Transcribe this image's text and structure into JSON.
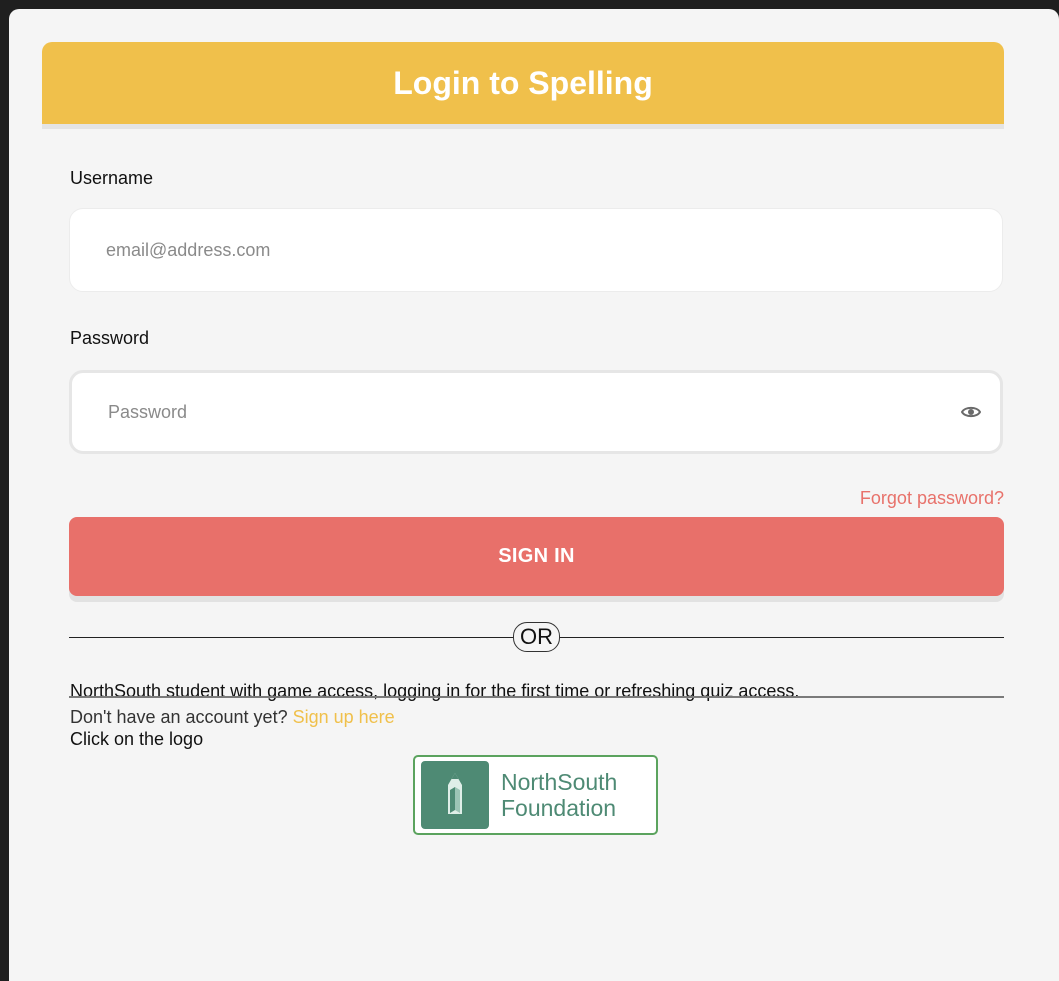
{
  "header": {
    "title": "Login to Spelling"
  },
  "username": {
    "label": "Username",
    "placeholder": "email@address.com",
    "value": ""
  },
  "password": {
    "label": "Password",
    "placeholder": "Password",
    "value": ""
  },
  "forgot_password": "Forgot password?",
  "sign_in_label": "SIGN IN",
  "divider_or": "OR",
  "northsouth_info": "NorthSouth student with game access, logging in for the first time or refreshing quiz access.",
  "click_logo": "Click on the logo",
  "logo": {
    "line1": "NorthSouth",
    "line2": "Foundation",
    "icon": "pencil-book-icon"
  },
  "signup": {
    "prompt": "Don't have an account yet?",
    "link": "Sign up here"
  },
  "colors": {
    "header": "#f0c04b",
    "primary_button": "#e8706a",
    "link_forgot": "#e8726b",
    "link_signup": "#f0c04b",
    "logo_green": "#4e8a74",
    "logo_border": "#5ba35e"
  }
}
